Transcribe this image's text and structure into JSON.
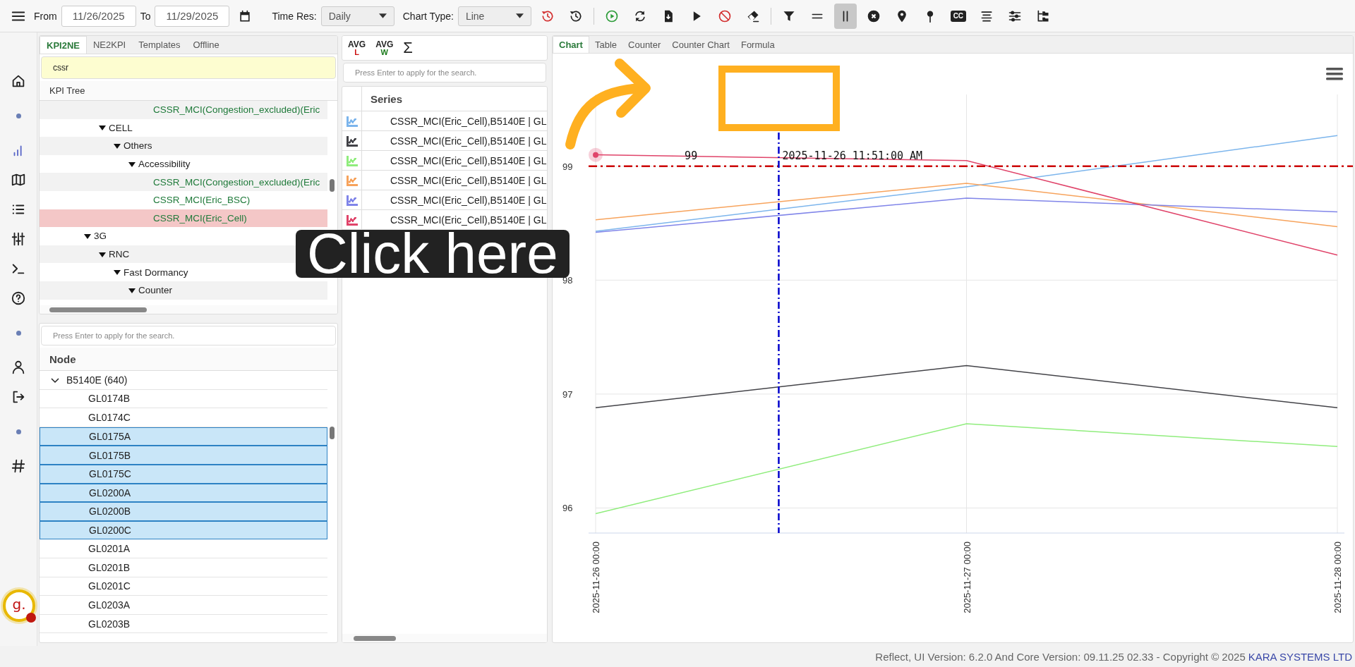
{
  "toolbar": {
    "from_label": "From",
    "from_date": "11/26/2025",
    "to_label": "To",
    "to_date": "11/29/2025",
    "time_res_label": "Time Res:",
    "time_res": "Daily",
    "chart_type_label": "Chart Type:",
    "chart_type": "Line",
    "tools": [
      {
        "kind": "history",
        "color": "#d32f2f",
        "selected": false
      },
      {
        "kind": "history",
        "color": "#222222",
        "selected": false
      },
      {
        "kind": "separator"
      },
      {
        "kind": "play-circle",
        "color": "#2e9d3a",
        "selected": false
      },
      {
        "kind": "refresh",
        "color": "#222222",
        "selected": false
      },
      {
        "kind": "file-download",
        "color": "#222222",
        "selected": false
      },
      {
        "kind": "play",
        "color": "#222222",
        "selected": false
      },
      {
        "kind": "ban",
        "color": "#d32f2f",
        "selected": false
      },
      {
        "kind": "eraser",
        "color": "#222222",
        "selected": false
      },
      {
        "kind": "separator"
      },
      {
        "kind": "filter",
        "color": "#222222",
        "selected": false
      },
      {
        "kind": "equals",
        "color": "#222222",
        "selected": false
      },
      {
        "kind": "pause",
        "color": "#222222",
        "selected": true
      },
      {
        "kind": "x-circle",
        "color": "#222222",
        "selected": false
      },
      {
        "kind": "pin",
        "color": "#222222",
        "selected": false
      },
      {
        "kind": "pushpin",
        "color": "#222222",
        "selected": false
      },
      {
        "kind": "cc",
        "label": "CC",
        "color": "#222222",
        "selected": false
      },
      {
        "kind": "lines",
        "color": "#222222",
        "selected": false
      },
      {
        "kind": "sliders",
        "color": "#222222",
        "selected": false
      },
      {
        "kind": "tree",
        "color": "#222222",
        "selected": false
      }
    ]
  },
  "sidebar": {
    "items": [
      {
        "kind": "home",
        "selected": false
      },
      {
        "kind": "dot"
      },
      {
        "kind": "chart",
        "selected": true
      },
      {
        "kind": "map",
        "selected": false
      },
      {
        "kind": "list",
        "selected": false
      },
      {
        "kind": "sliders",
        "selected": false
      },
      {
        "kind": "terminal",
        "selected": false
      },
      {
        "kind": "help",
        "selected": false
      },
      {
        "kind": "dot"
      },
      {
        "kind": "user",
        "selected": false
      },
      {
        "kind": "logout",
        "selected": false
      },
      {
        "kind": "dot"
      },
      {
        "kind": "hash",
        "selected": false
      }
    ]
  },
  "kpi_panel": {
    "tabs": [
      {
        "label": "KPI2NE",
        "selected": true
      },
      {
        "label": "NE2KPI",
        "selected": false
      },
      {
        "label": "Templates",
        "selected": false
      },
      {
        "label": "Offline",
        "selected": false
      }
    ],
    "search": {
      "value": "cssr"
    },
    "tree_header": "KPI Tree",
    "tree": [
      {
        "children": [
          {
            "children": [
              {
                "children": [
                  {
                    "children": [
                      {
                        "label": "CSSR_MCI(Congestion_excluded)(Eric",
                        "kind": "kpi",
                        "selected": false
                      }
                    ]
                  }
                ]
              }
            ]
          },
          {
            "label": "CELL",
            "kind": "group",
            "expanded": true,
            "children": [
              {
                "label": "Others",
                "kind": "group",
                "expanded": true,
                "children": [
                  {
                    "label": "Accessibility",
                    "kind": "group",
                    "expanded": true,
                    "children": [
                      {
                        "label": "CSSR_MCI(Congestion_excluded)(Eric",
                        "kind": "kpi",
                        "selected": false
                      },
                      {
                        "label": "CSSR_MCI(Eric_BSC)",
                        "kind": "kpi",
                        "selected": false
                      },
                      {
                        "label": "CSSR_MCI(Eric_Cell)",
                        "kind": "kpi",
                        "selected": true
                      }
                    ]
                  }
                ]
              }
            ]
          }
        ]
      },
      {
        "label": "3G",
        "kind": "group",
        "expanded": true,
        "children": [
          {
            "label": "RNC",
            "kind": "group",
            "expanded": true,
            "children": [
              {
                "label": "Fast Dormancy",
                "kind": "group",
                "expanded": true,
                "children": [
                  {
                    "label": "Counter",
                    "kind": "group",
                    "expanded": true
                  }
                ]
              }
            ]
          }
        ]
      }
    ]
  },
  "node_panel": {
    "search": {
      "placeholder": "Press Enter to apply for the search."
    },
    "header": "Node",
    "group": {
      "label": "B5140E (640)",
      "expanded": true
    },
    "rows": [
      {
        "label": "GL0174B",
        "selected": false
      },
      {
        "label": "GL0174C",
        "selected": false
      },
      {
        "label": "GL0175A",
        "selected": true
      },
      {
        "label": "GL0175B",
        "selected": true
      },
      {
        "label": "GL0175C",
        "selected": true
      },
      {
        "label": "GL0200A",
        "selected": true
      },
      {
        "label": "GL0200B",
        "selected": true
      },
      {
        "label": "GL0200C",
        "selected": true
      },
      {
        "label": "GL0201A",
        "selected": false
      },
      {
        "label": "GL0201B",
        "selected": false
      },
      {
        "label": "GL0201C",
        "selected": false
      },
      {
        "label": "GL0203A",
        "selected": false
      },
      {
        "label": "GL0203B",
        "selected": false
      }
    ]
  },
  "series_panel": {
    "tools": [
      {
        "kind": "avg",
        "top": "AVG",
        "bottom": "L",
        "color": "#cc1111"
      },
      {
        "kind": "avg",
        "top": "AVG",
        "bottom": "W",
        "color": "#1a7a1a"
      },
      {
        "kind": "sum",
        "top": "Σ"
      }
    ],
    "search": {
      "placeholder": "Press Enter to apply for the search."
    },
    "header": "Series",
    "rows": [
      {
        "label": "CSSR_MCI(Eric_Cell),B5140E | GL",
        "color": "#7cb5ec"
      },
      {
        "label": "CSSR_MCI(Eric_Cell),B5140E | GL",
        "color": "#434348"
      },
      {
        "label": "CSSR_MCI(Eric_Cell),B5140E | GL",
        "color": "#90ed7d"
      },
      {
        "label": "CSSR_MCI(Eric_Cell),B5140E | GL",
        "color": "#f7a35c"
      },
      {
        "label": "CSSR_MCI(Eric_Cell),B5140E | GL",
        "color": "#8085e9"
      },
      {
        "label": "CSSR_MCI(Eric_Cell),B5140E | GL",
        "color": "#e0446a"
      }
    ]
  },
  "chart_panel": {
    "tabs": [
      {
        "label": "Chart",
        "selected": true
      },
      {
        "label": "Table",
        "selected": false
      },
      {
        "label": "Counter",
        "selected": false
      },
      {
        "label": "Counter Chart",
        "selected": false
      },
      {
        "label": "Formula",
        "selected": false
      }
    ],
    "chart_data": {
      "type": "line",
      "categories": [
        "2025-11-26 00:00",
        "2025-11-27 00:00",
        "2025-11-28 00:00"
      ],
      "ylim": [
        95.78,
        99.63
      ],
      "yticks": [
        96,
        97,
        98,
        99
      ],
      "grid": true,
      "series": [
        {
          "color": "#7cb5ec",
          "values": [
            98.43,
            98.82,
            99.27
          ]
        },
        {
          "color": "#434348",
          "values": [
            96.88,
            97.25,
            96.88
          ]
        },
        {
          "color": "#90ed7d",
          "values": [
            95.95,
            96.74,
            96.54
          ]
        },
        {
          "color": "#f7a35c",
          "values": [
            98.53,
            98.85,
            98.47
          ]
        },
        {
          "color": "#8085e9",
          "values": [
            98.42,
            98.72,
            98.6
          ]
        },
        {
          "color": "#e0446a",
          "values": [
            99.1,
            99.05,
            98.22
          ]
        }
      ],
      "ref_lines": [
        {
          "axis": "y",
          "value": 99,
          "label": "99",
          "color": "#cc0000"
        }
      ]
    },
    "crosshair": {
      "label": "2025-11-26 11:51:00 AM"
    }
  },
  "footer": {
    "text": "Reflect, UI Version: 6.2.0 And Core Version: 09.11.25 02.33 - Copyright © 2025",
    "link": "KARA SYSTEMS LTD"
  },
  "guide_badge": {
    "letter": "g."
  },
  "tutorial": {
    "callout": "Click here"
  }
}
